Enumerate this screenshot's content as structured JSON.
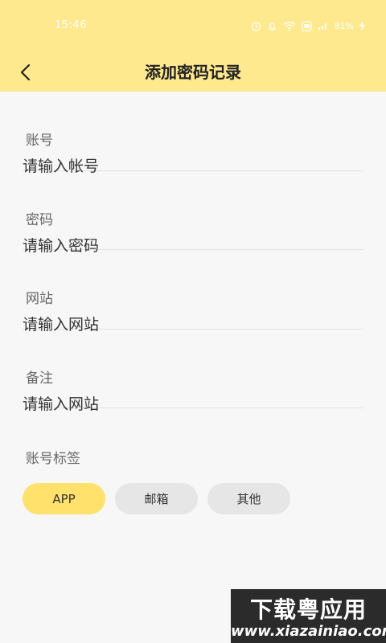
{
  "status_bar": {
    "time": "15:46",
    "battery": "81%"
  },
  "header": {
    "back_icon": "chevron-left-icon",
    "title": "添加密码记录"
  },
  "form": {
    "fields": [
      {
        "label": "账号",
        "placeholder": "请输入帐号"
      },
      {
        "label": "密码",
        "placeholder": "请输入密码"
      },
      {
        "label": "网站",
        "placeholder": "请输入网站"
      },
      {
        "label": "备注",
        "placeholder": "请输入网站"
      }
    ]
  },
  "tags": {
    "label": "账号标签",
    "options": [
      "APP",
      "邮箱",
      "其他"
    ],
    "selected": "APP"
  },
  "watermark": {
    "cn": "下载粤应用",
    "url": "www.xiazainiao.com"
  },
  "colors": {
    "header_bg": "#ffe98e",
    "tag_active": "#ffe16b",
    "tag_inactive": "#e6e6e6",
    "page_bg": "#f7f7f7"
  }
}
